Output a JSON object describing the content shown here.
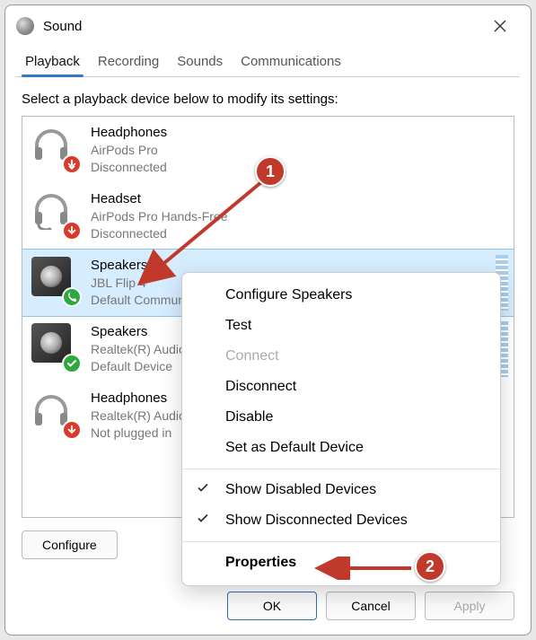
{
  "window": {
    "title": "Sound"
  },
  "tabs": [
    "Playback",
    "Recording",
    "Sounds",
    "Communications"
  ],
  "activeTab": 0,
  "instruction": "Select a playback device below to modify its settings:",
  "devices": [
    {
      "name": "Headphones",
      "line1": "AirPods Pro",
      "line2": "Disconnected",
      "iconType": "headphones",
      "status": "disconnected"
    },
    {
      "name": "Headset",
      "line1": "AirPods Pro Hands-Free",
      "line2": "Disconnected",
      "iconType": "headset",
      "status": "disconnected"
    },
    {
      "name": "Speakers",
      "line1": "JBL Flip 4",
      "line2": "Default Communications Device",
      "iconType": "speaker",
      "status": "phone",
      "selected": true,
      "levels": true
    },
    {
      "name": "Speakers",
      "line1": "Realtek(R) Audio",
      "line2": "Default Device",
      "iconType": "speaker",
      "status": "check",
      "levels": true
    },
    {
      "name": "Headphones",
      "line1": "Realtek(R) Audio",
      "line2": "Not plugged in",
      "iconType": "headphones",
      "status": "disconnected"
    }
  ],
  "buttons": {
    "configure": "Configure",
    "ok": "OK",
    "cancel": "Cancel",
    "apply": "Apply"
  },
  "contextMenu": {
    "items": [
      {
        "label": "Configure Speakers"
      },
      {
        "label": "Test"
      },
      {
        "label": "Connect",
        "disabled": true
      },
      {
        "label": "Disconnect"
      },
      {
        "label": "Disable"
      },
      {
        "label": "Set as Default Device"
      }
    ],
    "toggles": [
      {
        "label": "Show Disabled Devices",
        "checked": true
      },
      {
        "label": "Show Disconnected Devices",
        "checked": true
      }
    ],
    "properties": "Properties"
  },
  "annotations": {
    "badge1": "1",
    "badge2": "2"
  }
}
